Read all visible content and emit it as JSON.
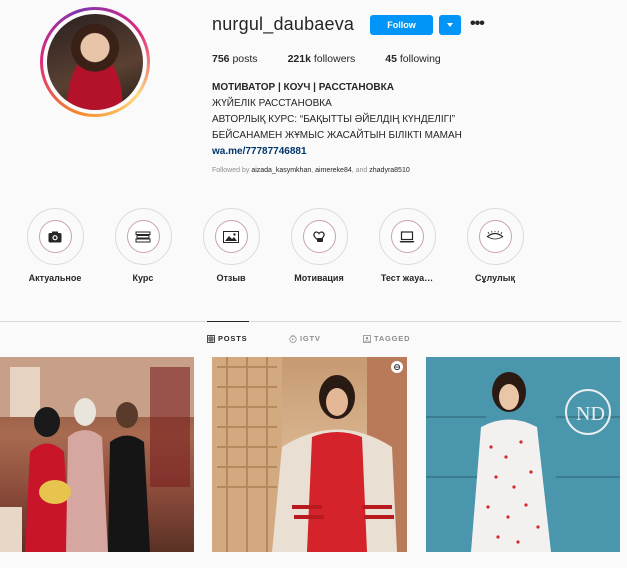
{
  "profile": {
    "username": "nurgul_daubaeva",
    "follow_label": "Follow",
    "more_glyph": "•••"
  },
  "stats": {
    "posts_count": "756",
    "posts_label": "posts",
    "followers_count": "221k",
    "followers_label": "followers",
    "following_count": "45",
    "following_label": "following"
  },
  "bio": {
    "name": "МОТИВАТОР | КОУЧ | РАССТАНОВКА",
    "line1": "ЖҮЙЕЛІК РАССТАНОВКА",
    "line2": "АВТОРЛЫҚ КУРС: “БАҚЫТТЫ ӘЙЕЛДІҢ КҮНДЕЛІГІ”",
    "line3": "БЕЙСАНАМЕН ЖҰМЫС ЖАСАЙТЫН БІЛІКТІ МАМАН",
    "link": "wa.me/77787746881"
  },
  "followed_by": {
    "prefix": "Followed by",
    "user1": "aizada_kasymkhan",
    "sep1": ",",
    "user2": "aimereke84",
    "sep2": ", and",
    "user3": "zhadyra8510"
  },
  "highlights": [
    {
      "label": "Актуальное",
      "icon": "camera-icon"
    },
    {
      "label": "Курс",
      "icon": "books-icon"
    },
    {
      "label": "Отзыв",
      "icon": "photo-icon"
    },
    {
      "label": "Мотивация",
      "icon": "heart-hand-icon"
    },
    {
      "label": "Тест жауа…",
      "icon": "laptop-icon"
    },
    {
      "label": "Сұлулық",
      "icon": "eye-icon"
    }
  ],
  "tabs": [
    {
      "label": "POSTS",
      "icon": "grid-icon",
      "active": true
    },
    {
      "label": "IGTV",
      "icon": "igtv-icon",
      "active": false
    },
    {
      "label": "TAGGED",
      "icon": "tag-icon",
      "active": false
    }
  ],
  "colors": {
    "accent": "#0095f6",
    "link": "#00376b",
    "muted": "#8e8e8e"
  }
}
